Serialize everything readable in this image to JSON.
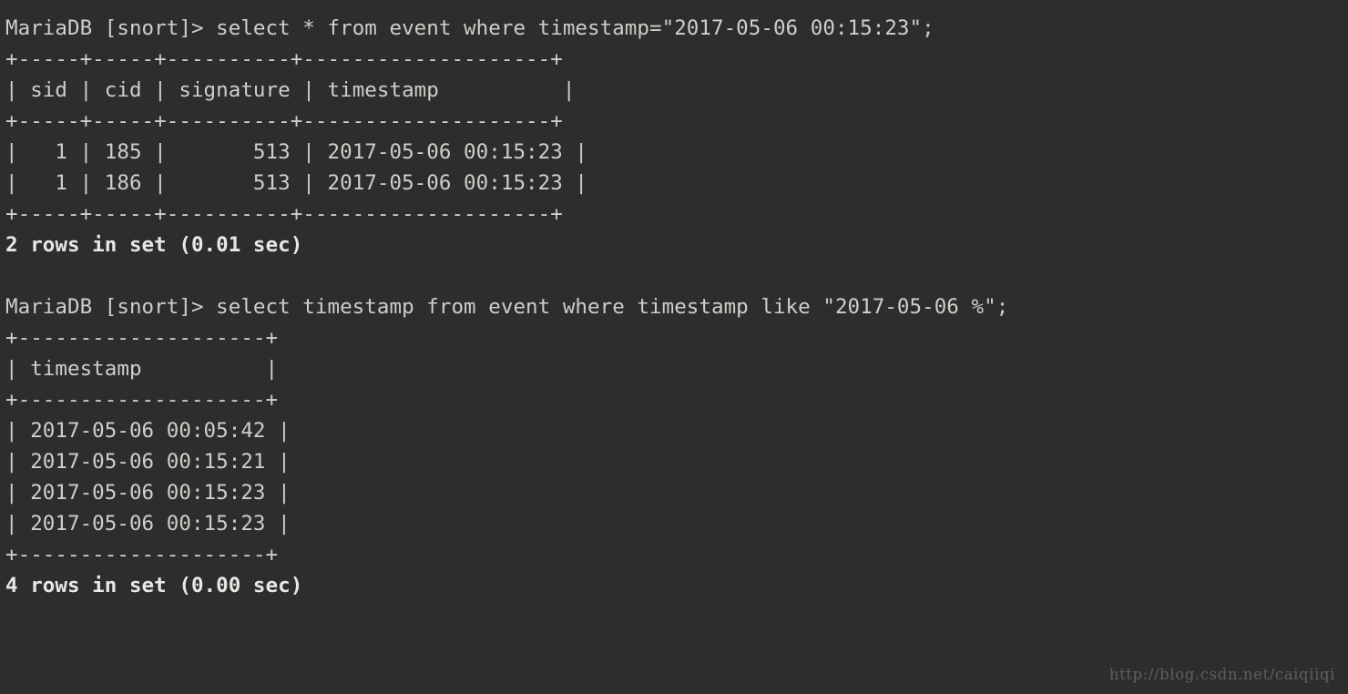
{
  "terminal": {
    "background_color": "#2d2d2d",
    "text_color": "#cfcec9",
    "bold_text_color": "#e8e7e3",
    "watermark_color": "#5e5e5c",
    "watermark": "http://blog.csdn.net/caiqiiqi"
  },
  "session": {
    "prompt": "MariaDB [snort]> ",
    "database": "snort",
    "blocks": [
      {
        "query_line": "MariaDB [snort]> select * from event where timestamp=\"2017-05-06 00:15:23\";",
        "query": "select * from event where timestamp=\"2017-05-06 00:15:23\";",
        "table": {
          "rule": "+-----+-----+----------+--------------------+",
          "header": "| sid | cid | signature | timestamp          |",
          "header_line": "| sid | cid | signature | timestamp           |",
          "columns": [
            "sid",
            "cid",
            "signature",
            "timestamp"
          ],
          "rows": [
            "|   1 | 185 |       513 | 2017-05-06 00:15:23 |",
            "|   1 | 186 |       513 | 2017-05-06 00:15:23 |"
          ],
          "row_values": [
            {
              "sid": "1",
              "cid": "185",
              "signature": "513",
              "timestamp": "2017-05-06 00:15:23"
            },
            {
              "sid": "1",
              "cid": "186",
              "signature": "513",
              "timestamp": "2017-05-06 00:15:23"
            }
          ]
        },
        "status": "2 rows in set (0.01 sec)",
        "row_count": 2,
        "duration": "0.01 sec"
      },
      {
        "query_line": "MariaDB [snort]> select timestamp from event where timestamp like \"2017-05-06 %\";",
        "query": "select timestamp from event where timestamp like \"2017-05-06 %\";",
        "table": {
          "rule": "+--------------------+",
          "header": "| timestamp          |",
          "columns": [
            "timestamp"
          ],
          "rows": [
            "| 2017-05-06 00:05:42 |",
            "| 2017-05-06 00:15:21 |",
            "| 2017-05-06 00:15:23 |",
            "| 2017-05-06 00:15:23 |"
          ],
          "row_values": [
            {
              "timestamp": "2017-05-06 00:05:42"
            },
            {
              "timestamp": "2017-05-06 00:15:21"
            },
            {
              "timestamp": "2017-05-06 00:15:23"
            },
            {
              "timestamp": "2017-05-06 00:15:23"
            }
          ]
        },
        "status": "4 rows in set (0.00 sec)",
        "row_count": 4,
        "duration": "0.00 sec"
      }
    ]
  },
  "lines": [
    {
      "text": "MariaDB [snort]> select * from event where timestamp=\"2017-05-06 00:15:23\";",
      "bold": false,
      "name": "query-line-1"
    },
    {
      "text": "+-----+-----+----------+--------------------+",
      "bold": false,
      "name": "table-rule-top-1"
    },
    {
      "text": "| sid | cid | signature | timestamp          |",
      "bold": false,
      "name": "table-header-1"
    },
    {
      "text": "+-----+-----+----------+--------------------+",
      "bold": false,
      "name": "table-rule-mid-1"
    },
    {
      "text": "|   1 | 185 |       513 | 2017-05-06 00:15:23 |",
      "bold": false,
      "name": "table-row-1-1"
    },
    {
      "text": "|   1 | 186 |       513 | 2017-05-06 00:15:23 |",
      "bold": false,
      "name": "table-row-1-2"
    },
    {
      "text": "+-----+-----+----------+--------------------+",
      "bold": false,
      "name": "table-rule-bottom-1"
    },
    {
      "text": "2 rows in set (0.01 sec)",
      "bold": true,
      "name": "status-line-1"
    },
    {
      "text": " ",
      "bold": false,
      "name": "blank-line-1"
    },
    {
      "text": "MariaDB [snort]> select timestamp from event where timestamp like \"2017-05-06 %\";",
      "bold": false,
      "name": "query-line-2"
    },
    {
      "text": "+--------------------+",
      "bold": false,
      "name": "table-rule-top-2"
    },
    {
      "text": "| timestamp          |",
      "bold": false,
      "name": "table-header-2"
    },
    {
      "text": "+--------------------+",
      "bold": false,
      "name": "table-rule-mid-2"
    },
    {
      "text": "| 2017-05-06 00:05:42 |",
      "bold": false,
      "name": "table-row-2-1"
    },
    {
      "text": "| 2017-05-06 00:15:21 |",
      "bold": false,
      "name": "table-row-2-2"
    },
    {
      "text": "| 2017-05-06 00:15:23 |",
      "bold": false,
      "name": "table-row-2-3"
    },
    {
      "text": "| 2017-05-06 00:15:23 |",
      "bold": false,
      "name": "table-row-2-4"
    },
    {
      "text": "+--------------------+",
      "bold": false,
      "name": "table-rule-bottom-2"
    },
    {
      "text": "4 rows in set (0.00 sec)",
      "bold": true,
      "name": "status-line-2"
    }
  ]
}
